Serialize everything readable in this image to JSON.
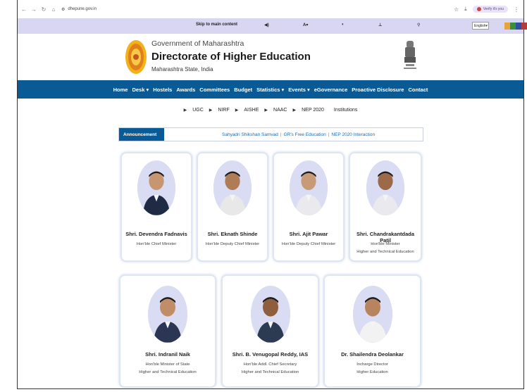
{
  "browser": {
    "url": "dhepune.gov.in",
    "verify_label": "Verify it's you"
  },
  "accessibility": {
    "skip_label": "Skip to main content",
    "font_size_label": "A",
    "language": "English"
  },
  "header": {
    "gov": "Government of Maharashtra",
    "dept": "Directorate of Higher Education",
    "state": "Maharashtra State, India"
  },
  "nav": {
    "items": [
      "Home",
      "Desk",
      "Hostels",
      "Awards",
      "Committees",
      "Budget",
      "Statistics",
      "Events",
      "eGovernance",
      "Proactive Disclosure",
      "Contact"
    ]
  },
  "subnav": {
    "items": [
      "UGC",
      "NIRF",
      "AISHE",
      "NAAC",
      "NEP 2020"
    ],
    "last": "Institutions"
  },
  "announcement": {
    "label": "Announcement",
    "links": [
      "Sahyadri Shikshan Samvad",
      "GR's Free Education",
      "NEP 2020 Interaction"
    ]
  },
  "people": [
    {
      "name": "Shri. Devendra Fadnavis",
      "role1": "Hon'ble Chief Minister",
      "role2": ""
    },
    {
      "name": "Shri. Eknath Shinde",
      "role1": "Hon'ble Deputy Chief Minister",
      "role2": ""
    },
    {
      "name": "Shri. Ajit Pawar",
      "role1": "Hon'ble Deputy Chief Minister",
      "role2": ""
    },
    {
      "name": "Shri. Chandrakantdada Patil",
      "role1": "Hon'ble Minister",
      "role2": "Higher and Technical Education"
    },
    {
      "name": "Shri. Indranil Naik",
      "role1": "Hon'ble Minister of State",
      "role2": "Higher and Technical Education"
    },
    {
      "name": "Shri. B. Venugopal Reddy, IAS",
      "role1": "Hon'ble Addl. Chief Secretary",
      "role2": "Higher and Technical Education"
    },
    {
      "name": "Dr. Shailendra Deolankar",
      "role1": "Incharge Director",
      "role2": "Higher Education"
    }
  ],
  "colors": {
    "nav_bg": "#0a5a96",
    "acc_bar": "#d9d6f2",
    "avatar_bg": "#d9dcf2",
    "link": "#1a6bb0"
  }
}
